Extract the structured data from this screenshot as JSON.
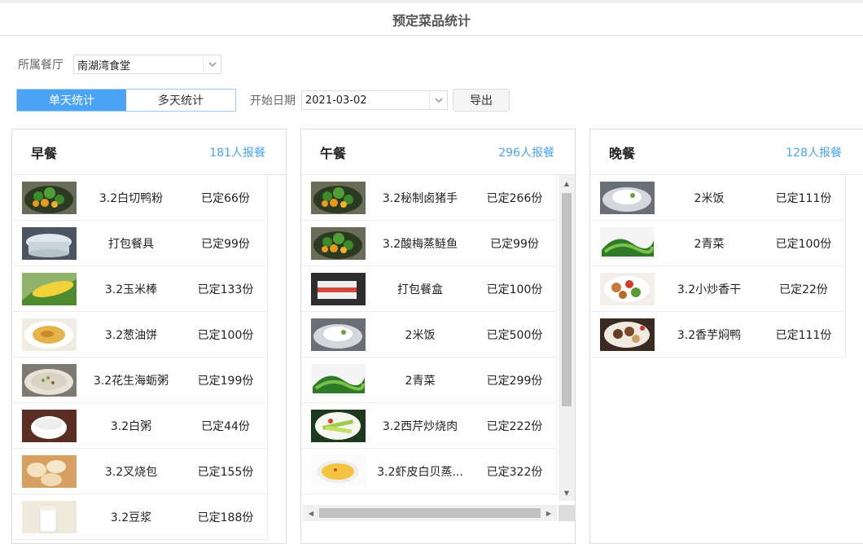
{
  "page": {
    "title": "预定菜品统计"
  },
  "filters": {
    "restaurant_label": "所属餐厅",
    "restaurant_value": "南湖湾食堂",
    "mode_tabs": [
      {
        "label": "单天统计",
        "active": true
      },
      {
        "label": "多天统计",
        "active": false
      }
    ],
    "start_date_label": "开始日期",
    "start_date_value": "2021-03-02",
    "export_label": "导出"
  },
  "panels": [
    {
      "title": "早餐",
      "count": "181人报餐",
      "items": [
        {
          "name": "3.2白切鸭粉",
          "qty": "已定66份",
          "icon": "veg-bowl"
        },
        {
          "name": "打包餐具",
          "qty": "已定99份",
          "icon": "plastic-box"
        },
        {
          "name": "3.2玉米棒",
          "qty": "已定133份",
          "icon": "corn"
        },
        {
          "name": "3.2葱油饼",
          "qty": "已定100份",
          "icon": "soup-plate"
        },
        {
          "name": "3.2花生海蛎粥",
          "qty": "已定199份",
          "icon": "porridge"
        },
        {
          "name": "3.2白粥",
          "qty": "已定44份",
          "icon": "white-porridge"
        },
        {
          "name": "3.2叉烧包",
          "qty": "已定155份",
          "icon": "dumplings"
        },
        {
          "name": "3.2豆浆",
          "qty": "已定188份",
          "icon": "soy-milk"
        }
      ]
    },
    {
      "title": "午餐",
      "count": "296人报餐",
      "items": [
        {
          "name": "3.2秘制卤猪手",
          "qty": "已定266份",
          "icon": "veg-bowl"
        },
        {
          "name": "3.2酸梅蒸鲢鱼",
          "qty": "已定99份",
          "icon": "veg-bowl"
        },
        {
          "name": "打包餐盒",
          "qty": "已定100份",
          "icon": "meal-box"
        },
        {
          "name": "2米饭",
          "qty": "已定500份",
          "icon": "rice"
        },
        {
          "name": "2青菜",
          "qty": "已定299份",
          "icon": "greens"
        },
        {
          "name": "3.2西芹炒烧肉",
          "qty": "已定222份",
          "icon": "celery"
        },
        {
          "name": "3.2虾皮白贝蒸...",
          "qty": "已定322份",
          "icon": "egg-custard"
        }
      ]
    },
    {
      "title": "晚餐",
      "count": "128人报餐",
      "items": [
        {
          "name": "2米饭",
          "qty": "已定111份",
          "icon": "rice"
        },
        {
          "name": "2青菜",
          "qty": "已定100份",
          "icon": "greens"
        },
        {
          "name": "3.2小炒香干",
          "qty": "已定22份",
          "icon": "stir-fry"
        },
        {
          "name": "3.2香芋焖鸭",
          "qty": "已定111份",
          "icon": "braised-duck"
        }
      ]
    }
  ]
}
